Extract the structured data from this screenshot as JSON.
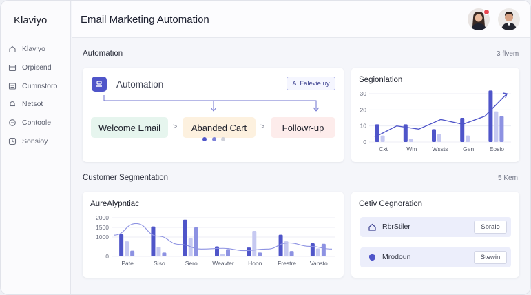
{
  "app": {
    "brand": "Klaviyo",
    "title": "Email Marketing Automation"
  },
  "sidebar": {
    "items": [
      {
        "label": "Klaviyo",
        "icon": "home-icon"
      },
      {
        "label": "Orpisend",
        "icon": "calendar-icon"
      },
      {
        "label": "Cumnstoro",
        "icon": "list-icon"
      },
      {
        "label": "Netsot",
        "icon": "bell-icon"
      },
      {
        "label": "Contoole",
        "icon": "chat-icon"
      },
      {
        "label": "Sonsioy",
        "icon": "clock-icon"
      }
    ]
  },
  "automation_section": {
    "title": "Automation",
    "count": "3 flvem"
  },
  "automation_card": {
    "label": "Automation",
    "follow_button": "Falevie uy",
    "flow": [
      "Welcome Email",
      "Abanded Cart",
      "Followr-up"
    ]
  },
  "segmentation_card": {
    "title": "Segionlation",
    "chart_data": {
      "type": "bar",
      "categories": [
        "Cxt",
        "Wm",
        "Wssts",
        "Gen",
        "Eosio"
      ],
      "ylim": [
        0,
        30
      ],
      "yticks": [
        "0",
        "10",
        "20",
        "30"
      ],
      "series": [
        {
          "values": [
            11,
            11,
            8,
            15,
            32
          ]
        },
        {
          "values": [
            4,
            2,
            5,
            4,
            19
          ]
        },
        {
          "values": [
            0,
            0,
            0,
            0,
            16
          ]
        }
      ],
      "trend": [
        3,
        10,
        8,
        14,
        11,
        16,
        30
      ]
    }
  },
  "customer_section": {
    "title": "Customer Segmentation",
    "count": "5 Kem"
  },
  "analytics_card": {
    "title": "AureAlypntiac",
    "chart_data": {
      "type": "bar",
      "categories": [
        "Pate",
        "Siso",
        "Sero",
        "Weavter",
        "Hoon",
        "Frestre",
        "Vansto"
      ],
      "ylim": [
        0,
        2000
      ],
      "yticks": [
        "2000",
        "1500",
        "1000",
        "0"
      ],
      "series": [
        {
          "values": [
            1150,
            1550,
            1900,
            520,
            460,
            1120,
            680
          ]
        },
        {
          "values": [
            780,
            500,
            940,
            140,
            1320,
            780,
            410
          ]
        },
        {
          "values": [
            300,
            200,
            1500,
            380,
            200,
            280,
            650
          ]
        }
      ]
    }
  },
  "segments_card": {
    "title": "Cetiv Cegnoration",
    "rows": [
      {
        "label": "RbrStiler",
        "button": "Sbraio",
        "icon": "home-icon"
      },
      {
        "label": "Mrodoun",
        "button": "Stewin",
        "icon": "shield-icon"
      }
    ]
  },
  "colors": {
    "accent": "#4f55c9",
    "accent_light": "#c6c9f1",
    "accent_mid": "#8d92e2"
  }
}
